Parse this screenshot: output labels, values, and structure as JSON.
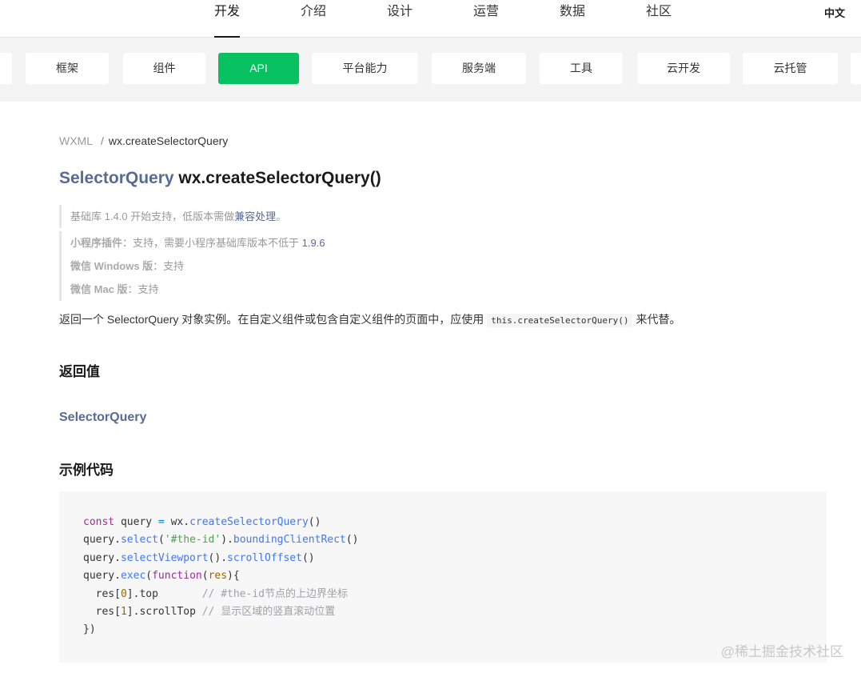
{
  "topnav": {
    "items": [
      "开发",
      "介绍",
      "设计",
      "运营",
      "数据",
      "社区"
    ],
    "active": "开发",
    "language": "中文"
  },
  "categories": {
    "items": [
      "框架",
      "组件",
      "API",
      "平台能力",
      "服务端",
      "工具",
      "云开发",
      "云托管"
    ],
    "active": "API"
  },
  "breadcrumb": {
    "parent": "WXML",
    "separator": "/",
    "current": "wx.createSelectorQuery"
  },
  "title": {
    "return_type": "SelectorQuery",
    "name": "wx.createSelectorQuery()"
  },
  "support_note": {
    "prefix": "基础库 1.4.0 开始支持，低版本需做",
    "link": "兼容处理",
    "suffix": "。"
  },
  "platform_notes": [
    {
      "label": "小程序插件",
      "text": "：支持，需要小程序基础库版本不低于 ",
      "version": "1.9.6"
    },
    {
      "label": "微信 Windows 版",
      "text": "：支持",
      "version": ""
    },
    {
      "label": "微信 Mac 版",
      "text": "：支持",
      "version": ""
    }
  ],
  "description": {
    "prefix": "返回一个 SelectorQuery 对象实例。在自定义组件或包含自定义组件的页面中，应使用",
    "code": "this.createSelectorQuery()",
    "suffix": "来代替。"
  },
  "sections": {
    "return_heading": "返回值",
    "return_type": "SelectorQuery",
    "example_heading": "示例代码"
  },
  "code_lines": [
    "const query = wx.createSelectorQuery()",
    "query.select('#the-id').boundingClientRect()",
    "query.selectViewport().scrollOffset()",
    "query.exec(function(res){",
    "  res[0].top       // #the-id节点的上边界坐标",
    "  res[1].scrollTop // 显示区域的竖直滚动位置",
    "})"
  ],
  "watermark": "@稀土掘金技术社区"
}
